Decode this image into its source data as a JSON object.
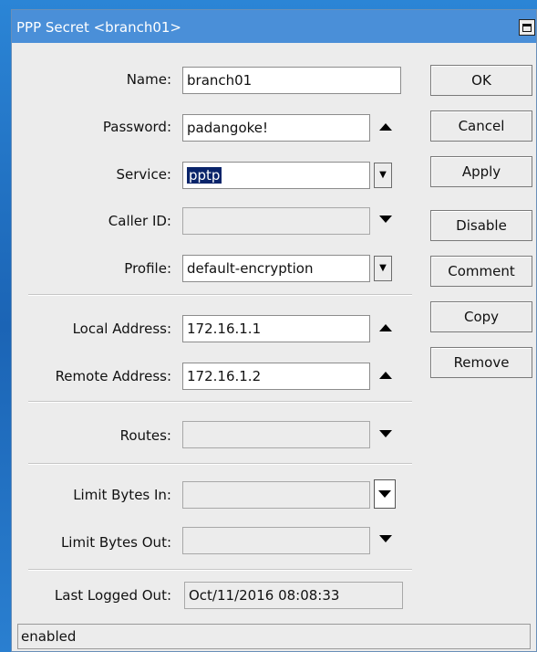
{
  "window": {
    "title": "PPP Secret <branch01>"
  },
  "fields": {
    "name": {
      "label": "Name:",
      "value": "branch01"
    },
    "password": {
      "label": "Password:",
      "value": "padangoke!"
    },
    "service": {
      "label": "Service:",
      "value": "pptp"
    },
    "caller_id": {
      "label": "Caller ID:",
      "value": ""
    },
    "profile": {
      "label": "Profile:",
      "value": "default-encryption"
    },
    "local_address": {
      "label": "Local Address:",
      "value": "172.16.1.1"
    },
    "remote_address": {
      "label": "Remote Address:",
      "value": "172.16.1.2"
    },
    "routes": {
      "label": "Routes:",
      "value": ""
    },
    "limit_bytes_in": {
      "label": "Limit Bytes In:",
      "value": ""
    },
    "limit_bytes_out": {
      "label": "Limit Bytes Out:",
      "value": ""
    },
    "last_logged_out": {
      "label": "Last Logged Out:",
      "value": "Oct/11/2016 08:08:33"
    }
  },
  "buttons": {
    "ok": "OK",
    "cancel": "Cancel",
    "apply": "Apply",
    "disable": "Disable",
    "comment": "Comment",
    "copy": "Copy",
    "remove": "Remove"
  },
  "status": {
    "text": "enabled"
  },
  "colors": {
    "titlebar": "#4a8fd8",
    "selection": "#0a246a",
    "window_bg": "#ececec"
  }
}
